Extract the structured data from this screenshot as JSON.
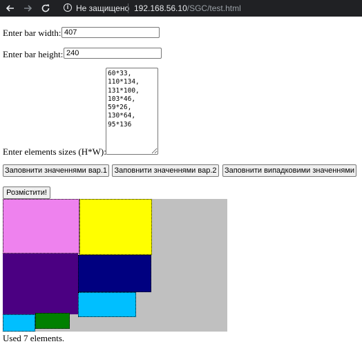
{
  "browser": {
    "security_label": "Не защищено",
    "url_host": "192.168.56.10",
    "url_path": "/SGC/test.html"
  },
  "form": {
    "width_label": "Enter bar width:",
    "width_value": "407",
    "height_label": "Enter bar height:",
    "height_value": "240",
    "sizes_label": "Enter elements sizes (H*W):",
    "sizes_value": "60*33,\n110*134,\n131*100,\n103*46,\n59*26,\n130*64,\n95*136"
  },
  "buttons": {
    "fill_v1": "Заповнити значеннями вар.1",
    "fill_v2": "Заповнити значеннями вар.2",
    "fill_random": "Заповнити випадковими значеннями",
    "place": "Розмістити!"
  },
  "colors": {
    "bar_background": "#c0c0c0",
    "element_colors": [
      "#ee82ee",
      "#ffff00",
      "#4b0082",
      "#000080",
      "#00bfff",
      "#00bfff",
      "#008000"
    ]
  },
  "status": "Used 7 elements."
}
